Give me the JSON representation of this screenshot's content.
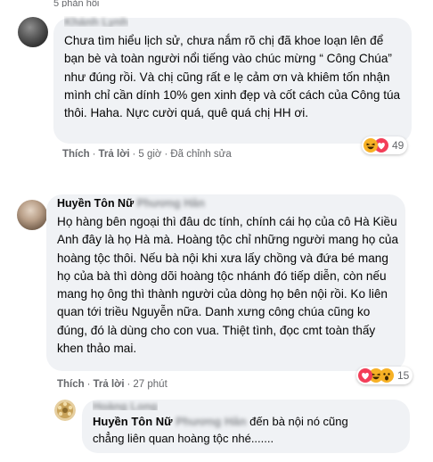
{
  "top_hint": "5 phản hồi",
  "comment1": {
    "author": "Khánh Lynh",
    "text": "Chưa tìm hiểu lịch sử, chưa nắm rõ chị đã khoe loạn lên để bạn bè và toàn người nổi tiếng vào chúc mừng “ Công Chúa” như đúng rồi. Và chị cũng rất e lẹ cảm ơn và khiêm tốn nhận mình chỉ cần dính 10% gen xinh đẹp và cốt cách của Công túa thôi. Haha. Nực cười quá, quê quá chị HH ơi.",
    "actions": {
      "like": "Thích",
      "reply": "Trả lời",
      "time": "5 giờ",
      "edited": "Đã chỉnh sửa"
    },
    "reactions": {
      "count": "49"
    }
  },
  "comment2": {
    "author_visible": "Huyền Tôn Nữ",
    "author_blurred": "Phương Hân",
    "text": "Họ hàng bên ngoại thì đâu dc tính, chính cái họ của cô Hà Kiều Anh đây là họ Hà mà. Hoàng tộc chỉ những người mang họ của hoàng tộc thôi. Nếu bà nội khi xưa lấy chồng và đứa bé mang họ của bà thì dòng dõi hoàng tộc nhánh đó tiếp diễn, còn nếu mang họ ông thì thành người của dòng họ bên nội rồi. Ko liên quan tới triều Nguyễn nữa. Danh xưng công chúa cũng ko đúng, đó là dùng cho con vua. Thiệt tình, đọc cmt toàn thấy khen thảo mai.",
    "actions": {
      "like": "Thích",
      "reply": "Trả lời",
      "time": "27 phút"
    },
    "reactions": {
      "count": "15"
    }
  },
  "reply1": {
    "author_blurred": "Hoàng Long",
    "mention_visible": "Huyền Tôn Nữ",
    "mention_blurred": "Phương Hân",
    "text_after_mention": "đến bà nội nó cũng",
    "text_line2": "chẳng liên quan hoàng tộc nhé......."
  },
  "colors": {
    "bubble": "#f0f2f5",
    "meta": "#65676b",
    "text": "#050505",
    "haha": "#f7b125",
    "heart": "#f33e58"
  }
}
